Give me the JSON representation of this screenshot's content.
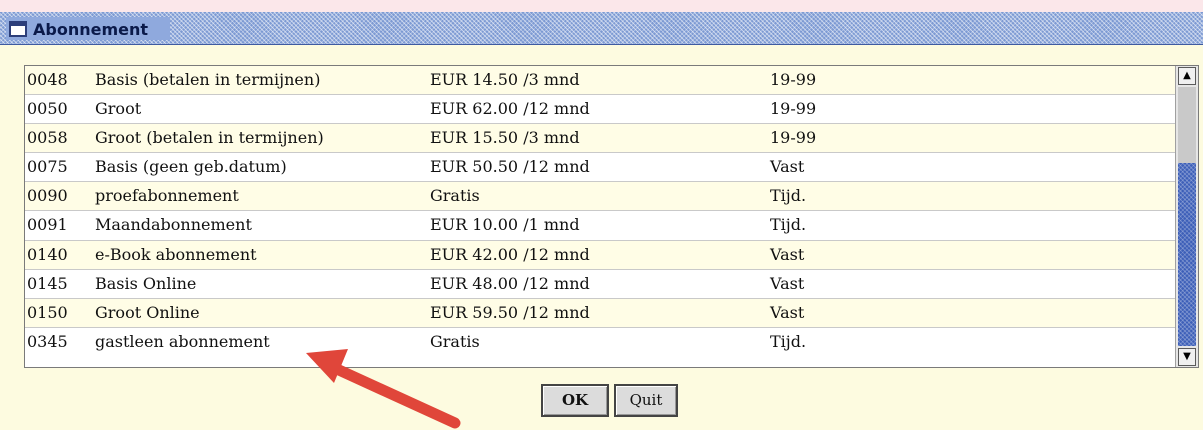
{
  "window": {
    "title": "Abonnement",
    "icon": "window-icon"
  },
  "subscriptions": [
    {
      "code": "0048",
      "name": "Basis (betalen in termijnen)",
      "price": "EUR 14.50 /3 mnd",
      "type": "19-99"
    },
    {
      "code": "0050",
      "name": "Groot",
      "price": "EUR 62.00 /12 mnd",
      "type": "19-99"
    },
    {
      "code": "0058",
      "name": "Groot (betalen in termijnen)",
      "price": "EUR 15.50 /3 mnd",
      "type": "19-99"
    },
    {
      "code": "0075",
      "name": "Basis (geen geb.datum)",
      "price": "EUR 50.50 /12 mnd",
      "type": "Vast"
    },
    {
      "code": "0090",
      "name": "proefabonnement",
      "price": "Gratis",
      "type": "Tijd."
    },
    {
      "code": "0091",
      "name": "Maandabonnement",
      "price": "EUR 10.00 /1 mnd",
      "type": "Tijd."
    },
    {
      "code": "0140",
      "name": "e-Book abonnement",
      "price": "EUR 42.00 /12 mnd",
      "type": "Vast"
    },
    {
      "code": "0145",
      "name": "Basis Online",
      "price": "EUR 48.00 /12 mnd",
      "type": "Vast"
    },
    {
      "code": "0150",
      "name": "Groot Online",
      "price": "EUR 59.50 /12 mnd",
      "type": "Vast"
    },
    {
      "code": "0345",
      "name": "gastleen abonnement",
      "price": "Gratis",
      "type": "Tijd."
    }
  ],
  "buttons": {
    "ok_label": "OK",
    "quit_label": "Quit"
  },
  "colors": {
    "background": "#fdfbe0",
    "titlebar": "#7d9ad3",
    "scroll_thumb": "#3d5fb8",
    "annotation_arrow": "#e0463a"
  }
}
